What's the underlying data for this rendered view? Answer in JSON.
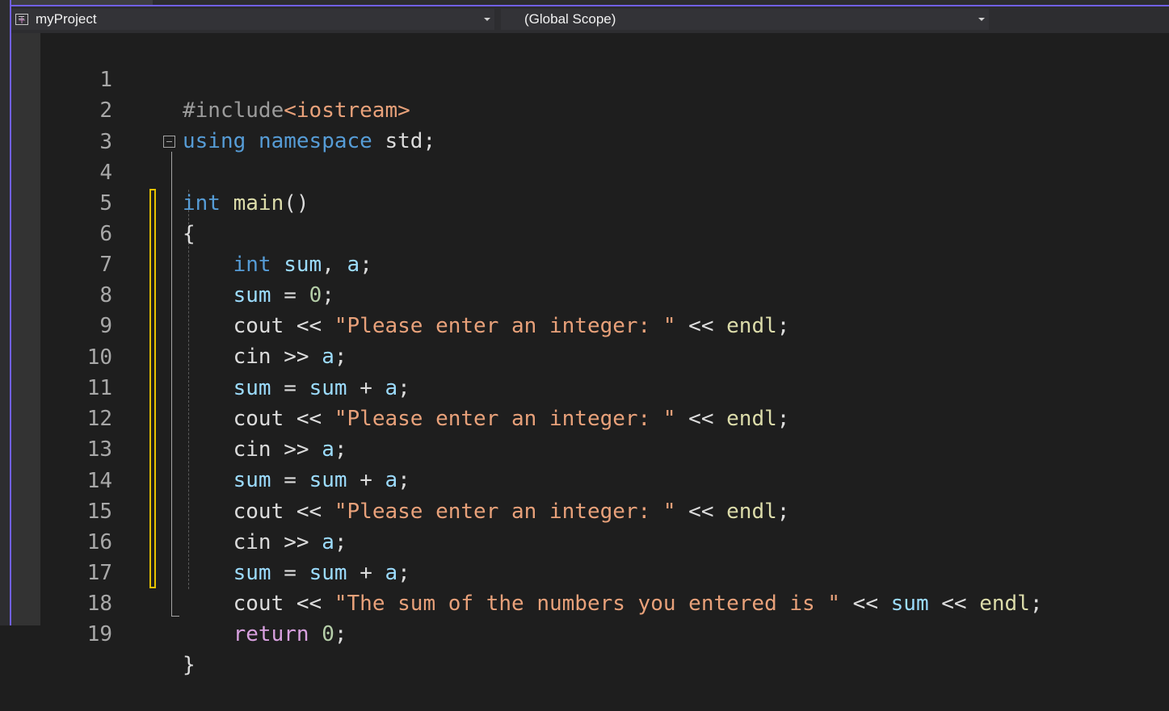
{
  "navbar": {
    "project": "myProject",
    "scope": "(Global Scope)"
  },
  "editor": {
    "line_numbers": [
      "1",
      "2",
      "3",
      "4",
      "5",
      "6",
      "7",
      "8",
      "9",
      "10",
      "11",
      "12",
      "13",
      "14",
      "15",
      "16",
      "17",
      "18",
      "19"
    ],
    "tokens": {
      "include": "#include",
      "header": "<iostream>",
      "using": "using",
      "namespace": "namespace",
      "std": "std",
      "int": "int",
      "main": "main",
      "parens": "()",
      "open_brace": "{",
      "close_brace": "}",
      "sum": "sum",
      "a": "a",
      "zero": "0",
      "cout": "cout",
      "cin": "cin",
      "endl": "endl",
      "return": "return",
      "shl": "<<",
      "shr": ">>",
      "assign": "=",
      "plus": "+",
      "comma": ",",
      "semi": ";",
      "str_prompt": "\"Please enter an integer: \"",
      "str_result": "\"The sum of the numbers you entered is \""
    }
  },
  "colors": {
    "background": "#1e1e1e",
    "accent": "#7160e8",
    "keyword": "#569cd6",
    "control_keyword": "#d8a0df",
    "string": "#e8a17a",
    "number": "#b5cea8",
    "variable": "#9cdcfe",
    "function": "#dcdcaa",
    "change_bar": "#e5c100"
  }
}
